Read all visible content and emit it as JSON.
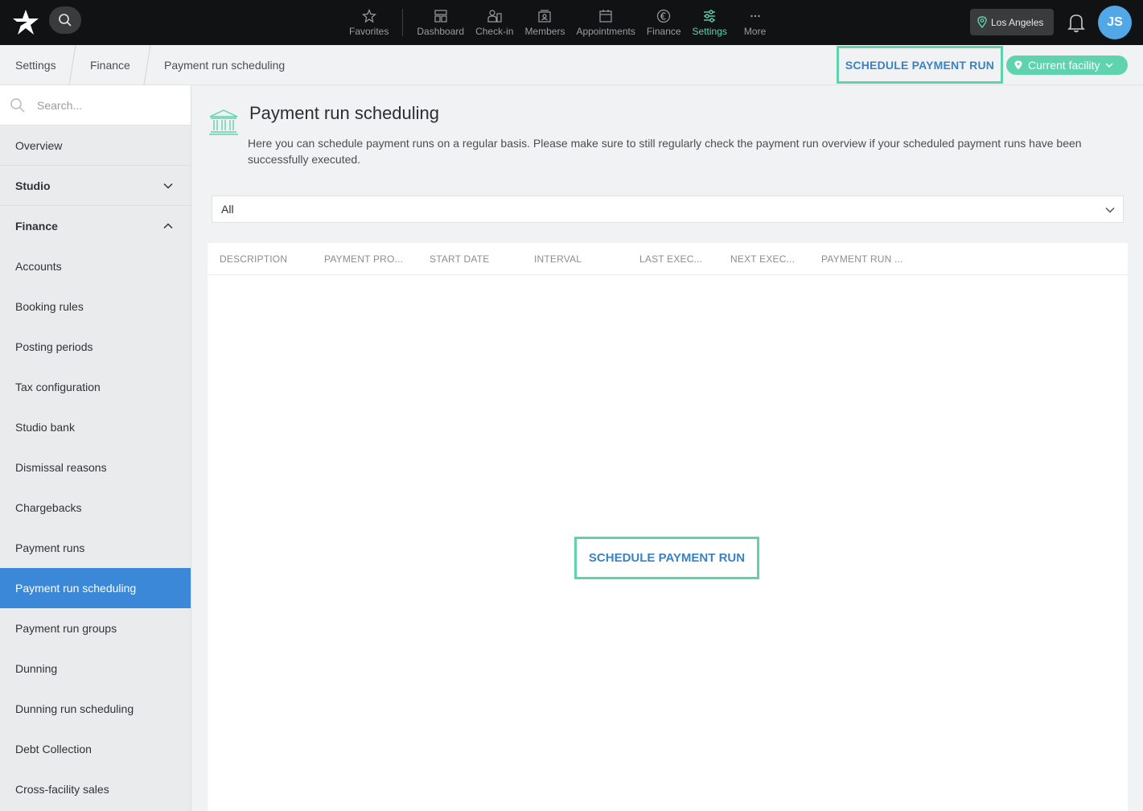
{
  "topbar": {
    "nav": [
      {
        "label": "Favorites",
        "icon": "star-icon"
      },
      {
        "label": "Dashboard",
        "icon": "dashboard-icon"
      },
      {
        "label": "Check-in",
        "icon": "check-in-icon"
      },
      {
        "label": "Members",
        "icon": "members-icon"
      },
      {
        "label": "Appointments",
        "icon": "calendar-icon"
      },
      {
        "label": "Finance",
        "icon": "euro-icon"
      },
      {
        "label": "Settings",
        "icon": "settings-sliders-icon"
      },
      {
        "label": "More",
        "icon": "more-icon"
      }
    ],
    "active_nav": "Settings",
    "location": "Los Angeles",
    "avatar_initials": "JS"
  },
  "breadcrumb": {
    "items": [
      "Settings",
      "Finance",
      "Payment run scheduling"
    ]
  },
  "actions": {
    "schedule_top": "SCHEDULE PAYMENT RUN",
    "facility": "Current facility"
  },
  "sidebar": {
    "search_placeholder": "Search...",
    "items": [
      {
        "label": "Overview"
      },
      {
        "label": "Studio"
      },
      {
        "label": "Finance"
      },
      {
        "label": "Accounts"
      },
      {
        "label": "Booking rules"
      },
      {
        "label": "Posting periods"
      },
      {
        "label": "Tax configuration"
      },
      {
        "label": "Studio bank"
      },
      {
        "label": "Dismissal reasons"
      },
      {
        "label": "Chargebacks"
      },
      {
        "label": "Payment runs"
      },
      {
        "label": "Payment run scheduling"
      },
      {
        "label": "Payment run groups"
      },
      {
        "label": "Dunning"
      },
      {
        "label": "Dunning run scheduling"
      },
      {
        "label": "Debt Collection"
      },
      {
        "label": "Cross-facility sales"
      }
    ],
    "active": "Payment run scheduling"
  },
  "main": {
    "title": "Payment run scheduling",
    "description": "Here you can schedule payment runs on a regular basis. Please make sure to still regularly check the payment run overview if your scheduled payment runs have been successfully executed.",
    "filter_value": "All",
    "columns": [
      "DESCRIPTION",
      "PAYMENT PRO...",
      "START DATE",
      "INTERVAL",
      "LAST EXEC...",
      "NEXT EXEC...",
      "PAYMENT RUN ..."
    ],
    "empty_action": "SCHEDULE PAYMENT RUN"
  },
  "colors": {
    "accent": "#5fd3ad",
    "link": "#3b82c4",
    "active_sidebar": "#3b87d8",
    "topbar": "#111213"
  }
}
